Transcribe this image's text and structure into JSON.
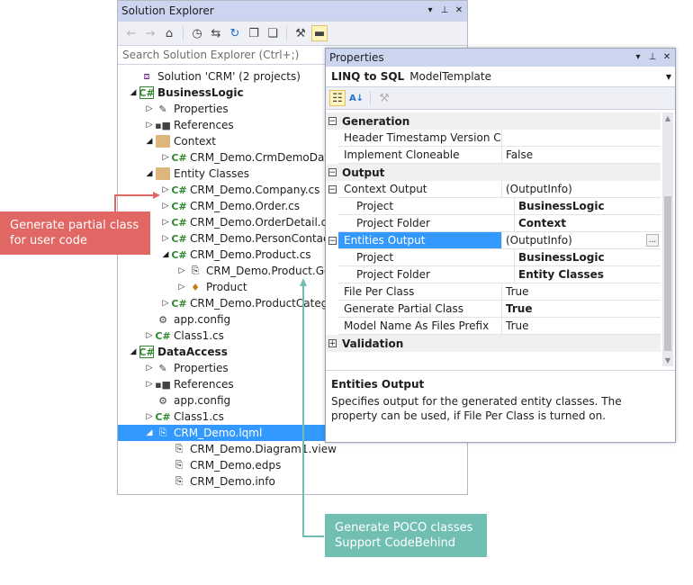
{
  "solution_explorer": {
    "title": "Solution Explorer",
    "search_placeholder": "Search Solution Explorer (Ctrl+;)",
    "title_buttons": [
      "▾",
      "⊓",
      "✕"
    ],
    "toolbar_icons": [
      "back-icon",
      "forward-icon",
      "home-icon",
      "history-icon",
      "sync-icon",
      "refresh-icon",
      "collapse-all-icon",
      "show-all-files-icon",
      "properties-icon",
      "preview-icon"
    ]
  },
  "tree": [
    {
      "label": "Solution 'CRM' (2 projects)",
      "arrow": "",
      "icon": "sol",
      "name": "solution-node"
    },
    {
      "label": "BusinessLogic",
      "arrow": "◢",
      "icon": "proj",
      "bold": true,
      "name": "project-businesslogic"
    },
    {
      "label": "Properties",
      "arrow": "▷",
      "icon": "wrench",
      "name": "properties-node"
    },
    {
      "label": "References",
      "arrow": "▷",
      "icon": "ref",
      "name": "references-node"
    },
    {
      "label": "Context",
      "arrow": "◢",
      "icon": "folder",
      "name": "folder-context"
    },
    {
      "label": "CRM_Demo.CrmDemoDataContext.cs",
      "arrow": "▷",
      "icon": "cs",
      "name": "file-datacontext"
    },
    {
      "label": "Entity Classes",
      "arrow": "◢",
      "icon": "folder",
      "name": "folder-entity-classes"
    },
    {
      "label": "CRM_Demo.Company.cs",
      "arrow": "▷",
      "icon": "cs",
      "name": "file-company"
    },
    {
      "label": "CRM_Demo.Order.cs",
      "arrow": "▷",
      "icon": "cs",
      "name": "file-order"
    },
    {
      "label": "CRM_Demo.OrderDetail.cs",
      "arrow": "▷",
      "icon": "cs",
      "name": "file-orderdetail"
    },
    {
      "label": "CRM_Demo.PersonContact.cs",
      "arrow": "▷",
      "icon": "cs",
      "name": "file-personcontact"
    },
    {
      "label": "CRM_Demo.Product.cs",
      "arrow": "◢",
      "icon": "cs",
      "name": "file-product"
    },
    {
      "label": "CRM_Demo.Product.Generated.cs",
      "arrow": "▷",
      "icon": "file",
      "name": "file-product-generated"
    },
    {
      "label": "Product",
      "arrow": "▷",
      "icon": "prod",
      "name": "class-product"
    },
    {
      "label": "CRM_Demo.ProductCategory.cs",
      "arrow": "▷",
      "icon": "cs",
      "name": "file-productcategory"
    },
    {
      "label": "app.config",
      "arrow": "",
      "icon": "cfg",
      "name": "file-appconfig"
    },
    {
      "label": "Class1.cs",
      "arrow": "▷",
      "icon": "cs",
      "name": "file-class1"
    },
    {
      "label": "DataAccess",
      "arrow": "◢",
      "icon": "proj",
      "bold": true,
      "name": "project-dataaccess"
    },
    {
      "label": "Properties",
      "arrow": "▷",
      "icon": "wrench",
      "name": "properties-node-da"
    },
    {
      "label": "References",
      "arrow": "▷",
      "icon": "ref",
      "name": "references-node-da"
    },
    {
      "label": "app.config",
      "arrow": "",
      "icon": "cfg",
      "name": "file-appconfig-da"
    },
    {
      "label": "Class1.cs",
      "arrow": "▷",
      "icon": "cs",
      "name": "file-class1-da"
    },
    {
      "label": "CRM_Demo.lqml",
      "arrow": "◢",
      "icon": "file",
      "selected": true,
      "name": "file-lqml"
    },
    {
      "label": "CRM_Demo.Diagram1.view",
      "arrow": "",
      "icon": "file",
      "name": "file-diagram-view"
    },
    {
      "label": "CRM_Demo.edps",
      "arrow": "",
      "icon": "file",
      "name": "file-edps"
    },
    {
      "label": "CRM_Demo.info",
      "arrow": "",
      "icon": "file",
      "name": "file-info"
    }
  ],
  "properties": {
    "title": "Properties",
    "object_type": "LINQ to SQL",
    "object_name": "ModelTemplate",
    "rows": [
      {
        "kind": "cat",
        "label": "Generation",
        "exp": "−"
      },
      {
        "kind": "prop",
        "name": "Header Timestamp Version Control",
        "value": ""
      },
      {
        "kind": "prop",
        "name": "Implement Cloneable",
        "value": "False"
      },
      {
        "kind": "cat",
        "label": "Output",
        "exp": "−"
      },
      {
        "kind": "prop",
        "name": "Context Output",
        "value": "(OutputInfo)",
        "exp": "−"
      },
      {
        "kind": "prop",
        "name": "Project",
        "value": "BusinessLogic",
        "indent": true,
        "bold": true
      },
      {
        "kind": "prop",
        "name": "Project Folder",
        "value": "Context",
        "indent": true,
        "bold": true
      },
      {
        "kind": "prop",
        "name": "Entities Output",
        "value": "(OutputInfo)",
        "exp": "−",
        "selected": true,
        "ellipsis": "..."
      },
      {
        "kind": "prop",
        "name": "Project",
        "value": "BusinessLogic",
        "indent": true,
        "bold": true
      },
      {
        "kind": "prop",
        "name": "Project Folder",
        "value": "Entity Classes",
        "indent": true,
        "bold": true
      },
      {
        "kind": "prop",
        "name": "File Per Class",
        "value": "True"
      },
      {
        "kind": "prop",
        "name": "Generate Partial Class",
        "value": "True",
        "bold": true
      },
      {
        "kind": "prop",
        "name": "Model Name As Files Prefix",
        "value": "True"
      },
      {
        "kind": "cat",
        "label": "Validation",
        "exp": "+"
      }
    ],
    "description_title": "Entities Output",
    "description_text": "Specifies output for the generated entity classes. The property can be used, if File Per Class is turned on."
  },
  "callouts": {
    "red": "Generate partial class for user code",
    "teal_line1": "Generate POCO classes",
    "teal_line2": "Support CodeBehind"
  },
  "colors": {
    "red": "#e06764",
    "teal": "#71bfb3",
    "selection": "#3399ff",
    "titlebar": "#ccd5f0"
  }
}
